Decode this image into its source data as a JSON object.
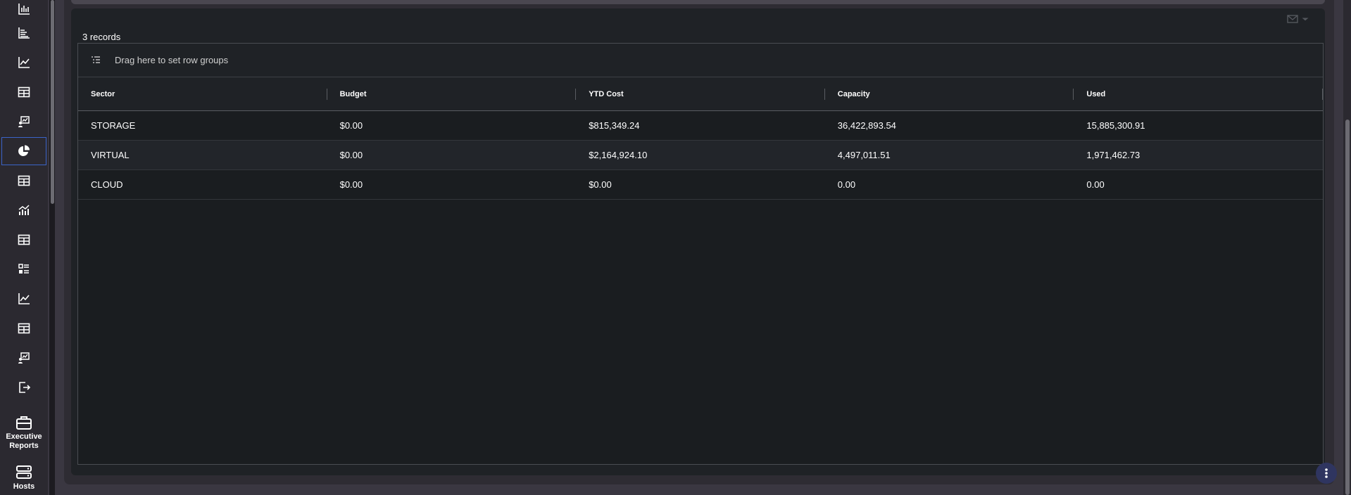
{
  "sidebar": {
    "icons": [
      {
        "name": "bar-chart-icon",
        "active": false
      },
      {
        "name": "horizontal-bar-chart-icon",
        "active": false
      },
      {
        "name": "line-chart-icon",
        "active": false
      },
      {
        "name": "table-icon",
        "active": false
      },
      {
        "name": "presentation-chart-icon",
        "active": false
      },
      {
        "name": "pie-chart-icon",
        "active": true
      },
      {
        "name": "table-icon",
        "active": false
      },
      {
        "name": "combo-chart-icon",
        "active": false
      },
      {
        "name": "table-icon",
        "active": false
      },
      {
        "name": "list-table-icon",
        "active": false
      },
      {
        "name": "line-chart-icon",
        "active": false
      },
      {
        "name": "table-icon",
        "active": false
      },
      {
        "name": "presentation-chart-icon",
        "active": false
      },
      {
        "name": "export-icon",
        "active": false
      }
    ],
    "sections": [
      {
        "label": "Executive Reports",
        "icon": "briefcase-icon"
      },
      {
        "label": "Hosts",
        "icon": "server-icon"
      }
    ]
  },
  "card": {
    "record_count": "3 records",
    "group_bar_text": "Drag here to set row groups"
  },
  "table": {
    "columns": [
      "Sector",
      "Budget",
      "YTD Cost",
      "Capacity",
      "Used"
    ],
    "rows": [
      [
        "STORAGE",
        "$0.00",
        "$815,349.24",
        "36,422,893.54",
        "15,885,300.91"
      ],
      [
        "VIRTUAL",
        "$0.00",
        "$2,164,924.10",
        "4,497,011.51",
        "1,971,462.73"
      ],
      [
        "CLOUD",
        "$0.00",
        "$0.00",
        "0.00",
        "0.00"
      ]
    ]
  },
  "colors": {
    "accent": "#3b64c9",
    "fab": "#2f3560"
  }
}
